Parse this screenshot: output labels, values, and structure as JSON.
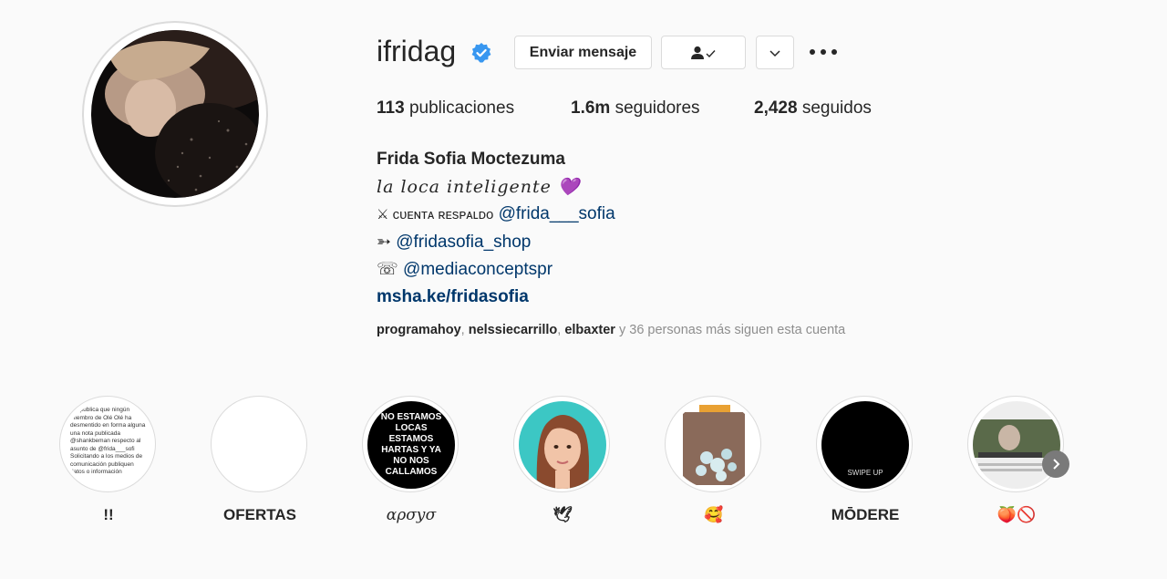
{
  "profile": {
    "username": "ifridag",
    "message_button": "Enviar mensaje",
    "stats": {
      "posts_count": "113",
      "posts_label": "publicaciones",
      "followers_count": "1.6m",
      "followers_label": "seguidores",
      "following_count": "2,428",
      "following_label": "seguidos"
    },
    "bio": {
      "name": "Frida Sofia Moctezuma",
      "tagline": "la loca inteligente 💜",
      "line2_prefix": "⚔ ᴄᴜᴇɴᴛᴀ ʀᴇsᴘᴀʟᴅᴏ",
      "line2_handle": "@frida___sofia",
      "line3_prefix": "➳",
      "line3_handle": "@fridasofia_shop",
      "line4_prefix": "☏",
      "line4_handle": "@mediaconceptspr",
      "website": "msha.ke/fridasofia"
    },
    "followed_by": {
      "user1": "programahoy",
      "user2": "nelssiecarrillo",
      "user3": "elbaxter",
      "rest": "y 36 personas más siguen esta cuenta"
    }
  },
  "highlights": [
    {
      "label": "!!"
    },
    {
      "label": "OFERTAS"
    },
    {
      "label": "ɑρσуσ"
    },
    {
      "label": "🕊"
    },
    {
      "label": "🥰"
    },
    {
      "label": "MŌDERE"
    },
    {
      "label": "🍑🚫"
    }
  ],
  "highlight_text": {
    "h1_text": "ión pública que ningún miembro de Olé Olé ha desmentido en forma alguna una nota publicada @shankbeman respecto al asunto de @frida___sofi Solicitando a los medios de comunicación publiquen datos o información",
    "h3_text": "NO ESTAMOS LOCAS ESTAMOS HARTAS Y YA NO NOS CALLAMOS",
    "h6_text": "SWIPE UP"
  },
  "colors": {
    "accent_link": "#00376b",
    "verified": "#3897f0",
    "muted": "#8e8e8e"
  }
}
